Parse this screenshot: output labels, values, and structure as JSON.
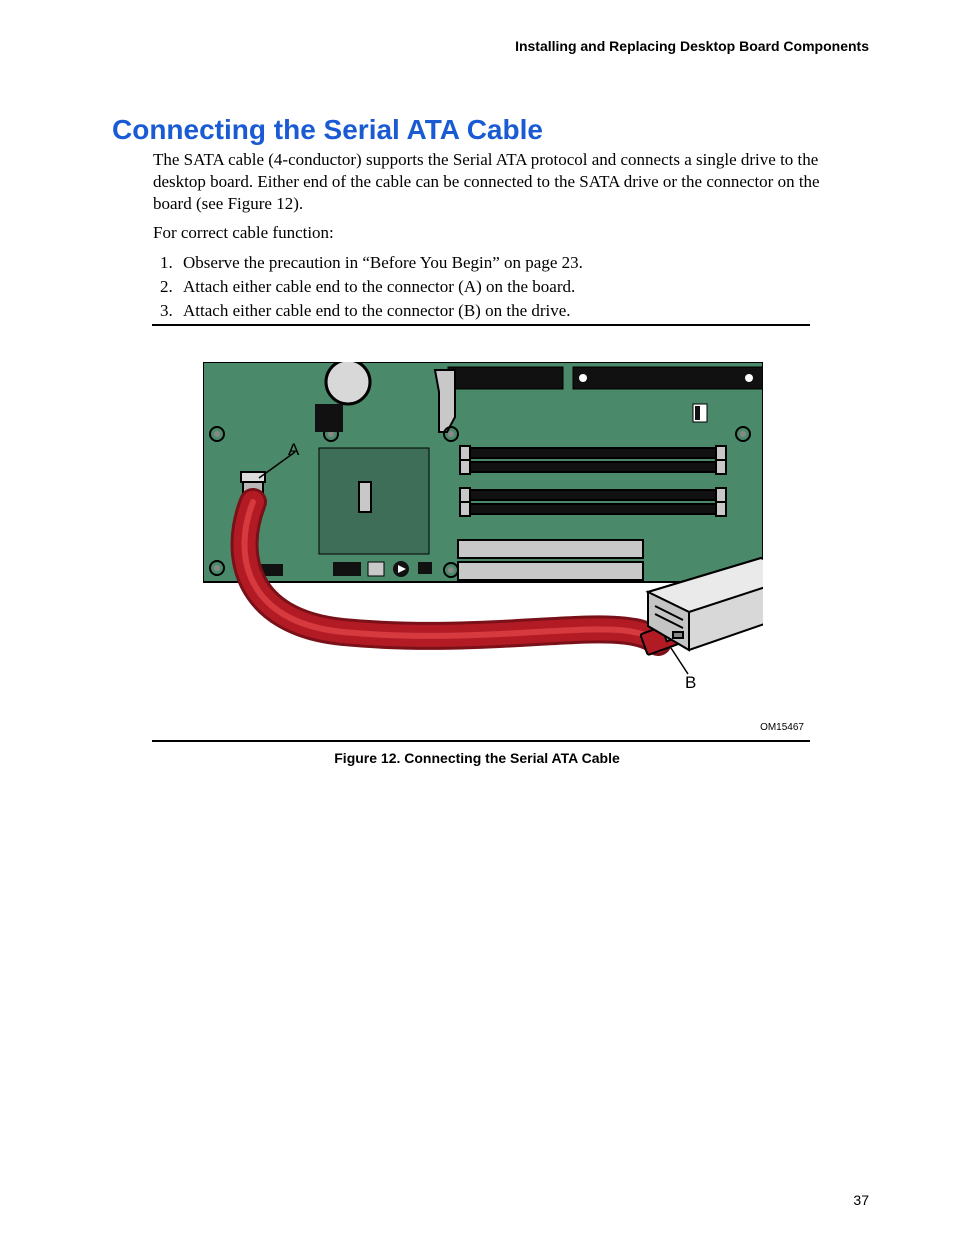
{
  "header": {
    "running_head": "Installing and Replacing Desktop Board Components"
  },
  "content": {
    "heading": "Connecting the Serial ATA Cable",
    "para1": "The SATA cable (4-conductor) supports the Serial ATA protocol and connects a single drive to the desktop board.  Either end of the cable can be connected to the SATA drive or the connector on the board (see Figure 12).",
    "para2": "For correct cable function:",
    "steps": [
      "Observe the precaution in “Before You Begin” on page 23.",
      "Attach either cable end to the connector (A) on the board.",
      "Attach either cable end to the connector (B) on the drive."
    ]
  },
  "figure": {
    "label_a": "A",
    "label_b": "B",
    "code": "OM15467",
    "caption": "Figure 12.  Connecting the Serial ATA Cable"
  },
  "footer": {
    "page_number": "37"
  }
}
